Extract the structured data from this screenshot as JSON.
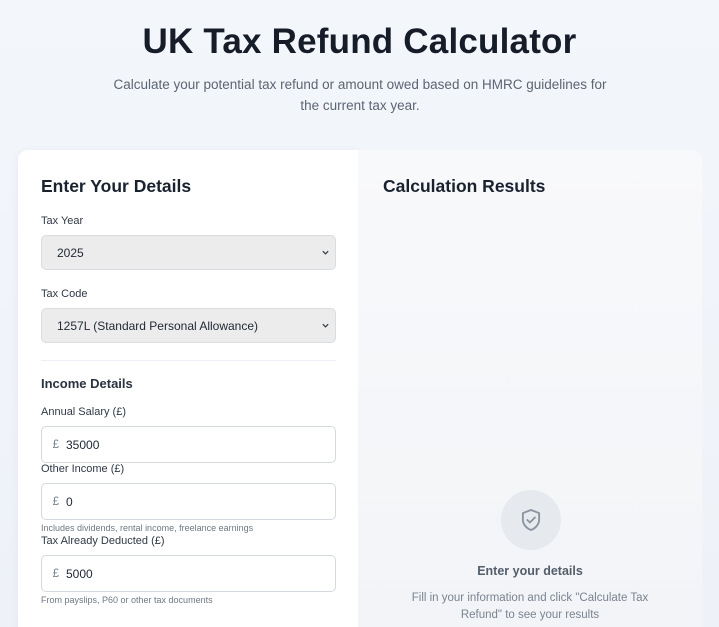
{
  "header": {
    "title": "UK Tax Refund Calculator",
    "subtitle": "Calculate your potential tax refund or amount owed based on HMRC guidelines for the current tax year."
  },
  "form": {
    "heading": "Enter Your Details",
    "tax_year": {
      "label": "Tax Year",
      "selected": "2025"
    },
    "tax_code": {
      "label": "Tax Code",
      "selected": "1257L (Standard Personal Allowance)"
    },
    "income_section": "Income Details",
    "annual_salary": {
      "label": "Annual Salary (£)",
      "currency": "£",
      "value": "35000"
    },
    "other_income": {
      "label": "Other Income (£)",
      "currency": "£",
      "value": "0",
      "helper": "Includes dividends, rental income, freelance earnings"
    },
    "tax_deducted": {
      "label": "Tax Already Deducted (£)",
      "currency": "£",
      "value": "5000",
      "helper": "From payslips, P60 or other tax documents"
    }
  },
  "results": {
    "heading": "Calculation Results",
    "empty_icon": "shield-check-icon",
    "empty_title": "Enter your details",
    "empty_text": "Fill in your information and click \"Calculate Tax Refund\" to see your results"
  }
}
